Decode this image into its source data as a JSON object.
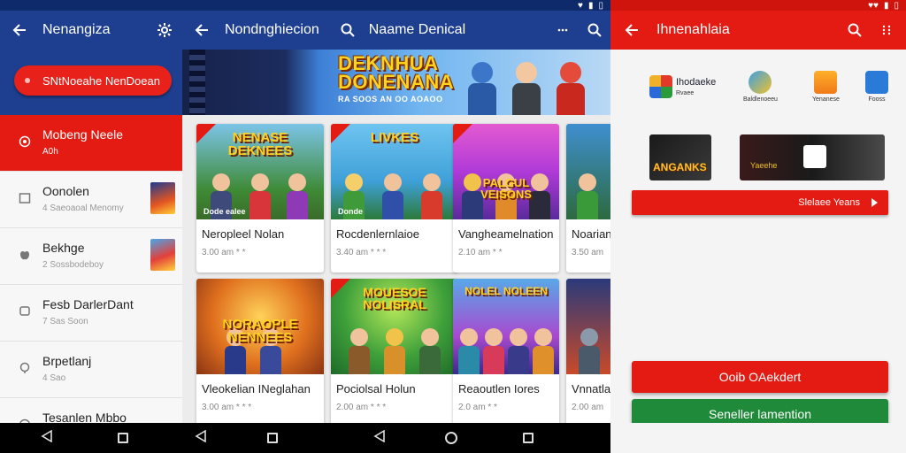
{
  "left_pane": {
    "title": "Nenangiza",
    "highlight_pill": "SNtNoeahe NenDoean",
    "items": [
      {
        "title": "Mobeng Neele",
        "subtitle": "A0h"
      },
      {
        "title": "Oonolen",
        "subtitle": "4 Saeoaoal Menomy"
      },
      {
        "title": "Bekhge",
        "subtitle": "2 Sossbodeboy"
      },
      {
        "title": "Fesb DarlerDant",
        "subtitle": "7 Sas Soon"
      },
      {
        "title": "Brpetlanj",
        "subtitle": "4 Sao"
      },
      {
        "title": "Tesanlen Mbbo",
        "subtitle": ""
      }
    ]
  },
  "middle_pane": {
    "title": "Nondnghiecion",
    "search_title": "Naame Denical",
    "banner": {
      "logo": "DEKNHUA DONENANA",
      "caption": "RA SOOS AN OO AOAOO"
    },
    "cards": [
      {
        "art_title": "NENASE DEKNEES",
        "caption": "Dode ealee",
        "name": "Neropleel Nolan",
        "meta": "3.00 am  * *"
      },
      {
        "art_title": "LIVKES",
        "caption": "Donde",
        "name": "Rocdenlernlaioe",
        "meta": "3.40 am  * * *"
      },
      {
        "art_title": "PALGUL VEISONS",
        "caption": "",
        "name": "Vangheamelnation",
        "meta": "2.10 am  * *"
      },
      {
        "art_title": "",
        "caption": "",
        "name": "Noarian",
        "meta": "3.50 am"
      },
      {
        "art_title": "NORAOPLE NENNEES",
        "caption": "",
        "name": "Vleokelian INeglahan",
        "meta": "3.00 am  * * *"
      },
      {
        "art_title": "MOUESOE NOLISRAL",
        "caption": "",
        "name": "Pociolsal Holun",
        "meta": "2.00 am  * * *"
      },
      {
        "art_title": "NOLEL NOLEEN",
        "caption": "",
        "name": "Reaoutlen Iores",
        "meta": "2.0 am  * *"
      },
      {
        "art_title": "",
        "caption": "",
        "name": "Vnnatlan",
        "meta": "2.00 am"
      }
    ]
  },
  "right_pane": {
    "title": "Ihnenahlaia",
    "brands": [
      {
        "name": "Ihodaeke",
        "caption": "Rvaee"
      },
      {
        "name": "",
        "caption": "Baldlenoeeu"
      },
      {
        "name": "",
        "caption": "Yenanese"
      },
      {
        "name": "",
        "caption": "Fooss"
      }
    ],
    "tiles": [
      {
        "label": "ANGANKS"
      },
      {
        "label": "Yaeehe"
      }
    ],
    "small_button": "Slelaee Yeans",
    "primary_button": "Ooib OAekdert",
    "secondary_button": "Seneller lamention"
  },
  "colors": {
    "appbar_blue": "#1e3f8f",
    "accent_red": "#e31b12",
    "action_green": "#1f8a3a"
  },
  "icons": [
    "back-arrow-icon",
    "settings-icon",
    "search-icon",
    "more-vert-icon",
    "nav-back-icon",
    "nav-home-icon",
    "nav-recents-icon"
  ]
}
